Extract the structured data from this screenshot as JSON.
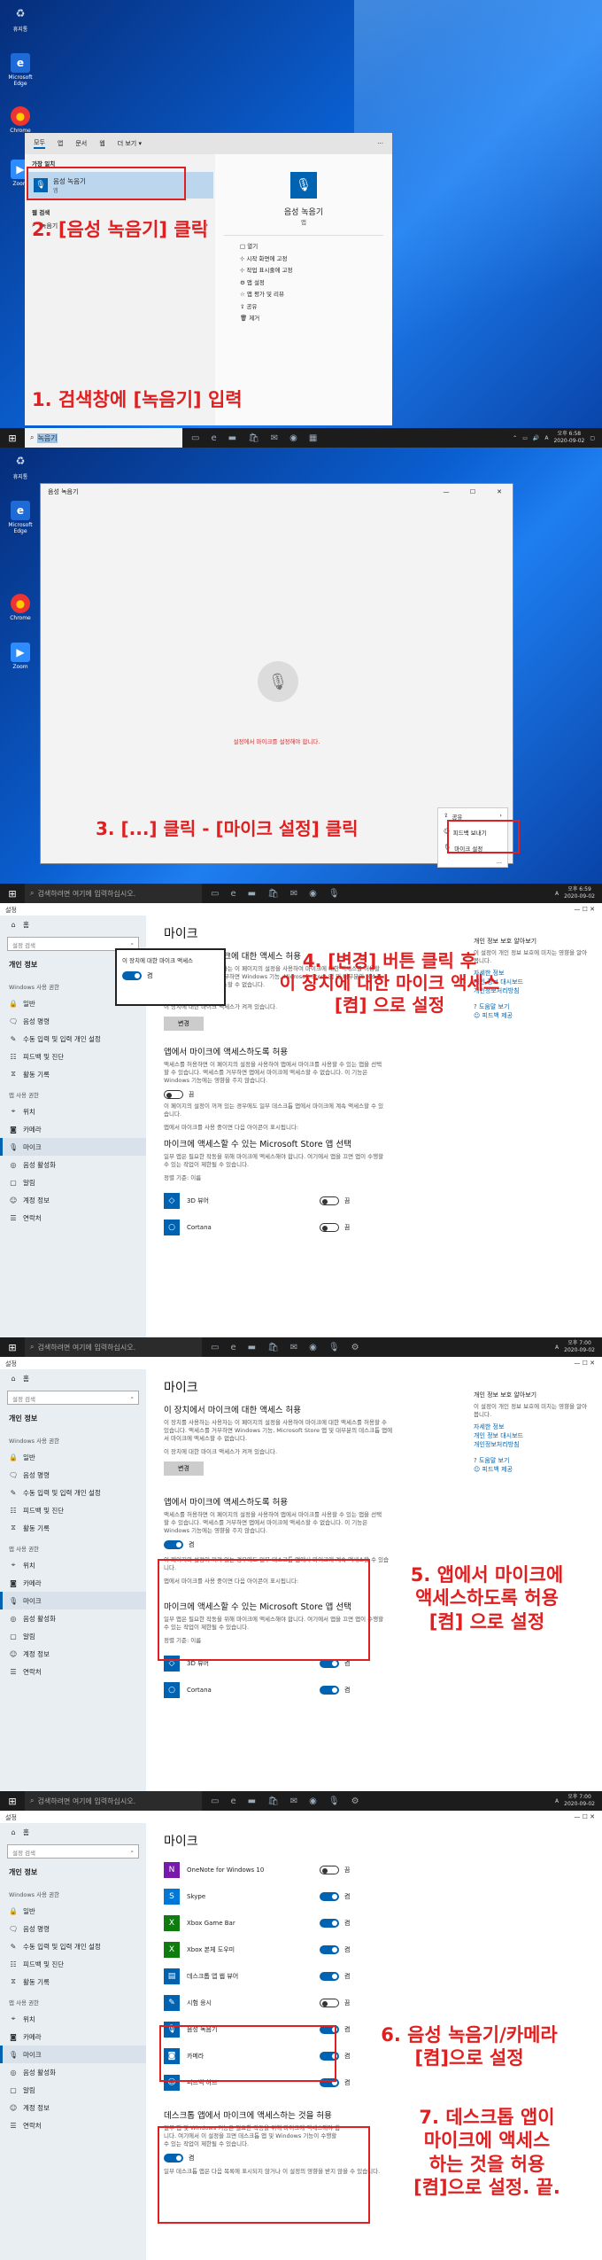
{
  "taskbar": {
    "search_placeholder": "검색하려면 여기에 입력하십시오.",
    "panel1_query": "녹음기",
    "panel1_time": "오후 6:58",
    "panel1_date": "2020-09-02",
    "panel2_time": "오후 6:59",
    "panel2_date": "2020-09-02",
    "panel3_time": "오후 6:59",
    "panel3_date": "2020-09-02",
    "panel4_time": "오후 7:00",
    "panel4_date": "2020-09-02",
    "panel5_time": "오후 7:00",
    "panel5_date": "2020-09-02",
    "tray_lang": "A"
  },
  "desktop_icons": {
    "recycle": "휴지통",
    "edge": "Microsoft Edge",
    "chrome": "Chrome",
    "zoom": "Zoom"
  },
  "search_panel": {
    "tabs": [
      "모두",
      "앱",
      "문서",
      "웹",
      "더 보기 ▾"
    ],
    "best_match_heading": "가장 일치",
    "result_name": "음성 녹음기",
    "result_type": "앱",
    "web_heading": "웹 검색",
    "web_query": "녹음기",
    "preview_title": "음성 녹음기",
    "preview_sub": "앱",
    "actions": [
      "열기",
      "시작 화면에 고정",
      "작업 표시줄에 고정",
      "앱 설정",
      "앱 평가 및 리뷰",
      "공유",
      "제거"
    ]
  },
  "recorder": {
    "title": "음성 녹음기",
    "message": "설정에서 마이크를 설정해야 합니다.",
    "menu": [
      "공유",
      "피드백 보내기",
      "마이크 설정"
    ],
    "more": "..."
  },
  "settings": {
    "title": "설정",
    "home": "홈",
    "search_placeholder": "설정 검색",
    "section": "개인 정보",
    "windows_perm_heading": "Windows 사용 권한",
    "windows_perms": [
      "일반",
      "음성 명령",
      "수동 입력 및 입력 개인 설정",
      "피드백 및 진단",
      "활동 기록"
    ],
    "app_perm_heading": "앱 사용 권한",
    "app_perms": [
      "위치",
      "카메라",
      "마이크",
      "음성 활성화",
      "알림",
      "계정 정보",
      "연락처"
    ],
    "page_title": "마이크",
    "device_heading": "이 장치에서 마이크에 대한 액세스 허용",
    "device_desc": "이 장치를 사용하는 사용자는 이 페이지의 설정을 사용하여 마이크에 대한 액세스를 허용할 수 있습니다. 액세스를 거부하면 Windows 기능, Microsoft Store 앱 및 대부분의 데스크톱 앱에서 마이크에 액세스할 수 없습니다.",
    "device_status": "이 장치에 대한 마이크 액세스가 켜져 있습니다.",
    "device_popup_label": "이 장치에 대한 마이크 액세스",
    "on": "켬",
    "off": "끔",
    "change": "변경",
    "apps_heading": "앱에서 마이크에 액세스하도록 허용",
    "apps_desc": "액세스를 허용하면 이 페이지의 설정을 사용하여 앱에서 마이크를 사용할 수 있는 앱을 선택할 수 있습니다. 액세스를 거부하면 앱에서 마이크에 액세스할 수 없습니다. 이 기능은 Windows 기능에는 영향을 주지 않습니다.",
    "apps_note": "이 페이지의 설정이 꺼져 있는 경우에도 일부 데스크톱 앱에서 마이크에 계속 액세스할 수 있습니다.",
    "apps_link": "이유 확인하세요",
    "apps_icon_note": "앱에서 마이크를 사용 중이면 다음 아이콘이 표시됩니다:",
    "store_heading": "마이크에 액세스할 수 있는 Microsoft Store 앱 선택",
    "store_desc": "일부 앱은 필요한 작동을 위해 마이크에 액세스해야 합니다. 여기에서 앱을 끄면 앱이 수행할 수 있는 작업이 제한될 수 있습니다.",
    "sort": "정렬 기준: 이름",
    "apps_list_a": [
      "3D 뷰어",
      "Cortana"
    ],
    "apps_list_b": [
      "OneNote for Windows 10",
      "Skype",
      "Xbox Game Bar",
      "Xbox 본체 도우미",
      "데스크톱 앱 웹 뷰어",
      "시험 응시",
      "음성 녹음기",
      "카메라",
      "피드백 허브"
    ],
    "apps_list_b_states": [
      "끔",
      "켬",
      "켬",
      "켬",
      "켬",
      "끔",
      "켬",
      "켬",
      "켬"
    ],
    "desktop_heading": "데스크톱 앱에서 마이크에 액세스하는 것을 허용",
    "desktop_desc": "일부 앱 및 Windows 기능은 필요한 작동을 위해 마이크에 액세스해야 합니다. 여기에서 이 설정을 끄면 데스크톱 앱 및 Windows 기능이 수행할 수 있는 작업이 제한될 수 있습니다.",
    "desktop_note": "일부 데스크톱 앱은 다음 목록에 표시되지 않거나 이 설정의 영향을 받지 않을 수 있습니다.",
    "side_heading": "개인 정보 보호 알아보기",
    "side_desc": "이 설정이 개인 정보 보호에 미치는 영향을 알아봅니다.",
    "side_links": [
      "자세한 정보",
      "개인 정보 대시보드",
      "개인정보처리방침"
    ],
    "help_links": [
      "도움말 보기",
      "피드백 제공"
    ]
  },
  "annotations": {
    "a1": "1. 검색창에 [녹음기] 입력",
    "a2": "2. [음성 녹음기] 클릭",
    "a3": "3. [...] 클릭 - [마이크 설정] 클릭",
    "a4_l1": "4. [변경] 버튼 클릭 후",
    "a4_l2": "이 장치에 대한 마이크 액세스",
    "a4_l3": "[켬] 으로 설정",
    "a5_l1": "5. 앱에서 마이크에",
    "a5_l2": "액세스하도록 허용",
    "a5_l3": "[켬] 으로 설정",
    "a6_l1": "6. 음성 녹음기/카메라",
    "a6_l2": "[켬]으로 설정",
    "a7_l1": "7. 데스크톱 앱이",
    "a7_l2": "마이크에 액세스",
    "a7_l3": "하는 것을 허용",
    "a7_l4": "[켬]으로 설정. 끝."
  },
  "colors": {
    "accent": "#0063b1",
    "annotation": "#e02020"
  }
}
